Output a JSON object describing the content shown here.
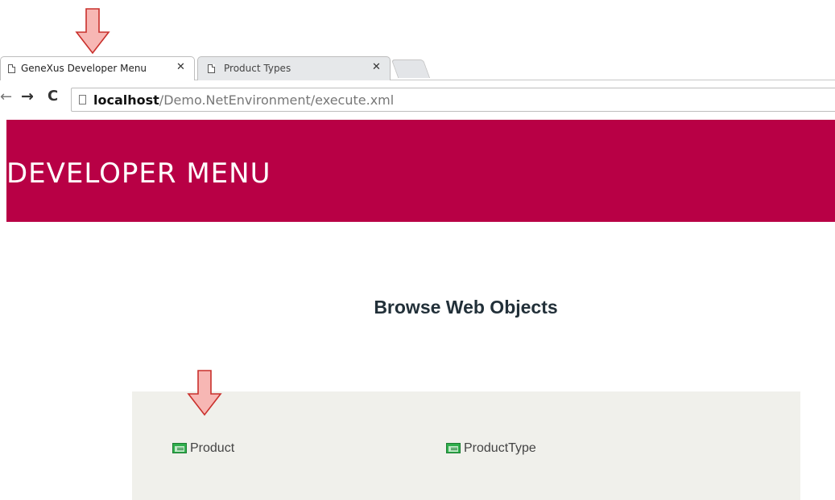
{
  "browser": {
    "tabs": [
      {
        "title": "GeneXus Developer Menu",
        "close": "✕",
        "active": true
      },
      {
        "title": "Product Types",
        "close": "✕",
        "active": false
      }
    ],
    "nav": {
      "back": "←",
      "forward": "→",
      "reload": "C"
    },
    "address": {
      "host": "localhost",
      "path": "/Demo.NetEnvironment/execute.xml"
    }
  },
  "page": {
    "header_title": "DEVELOPER MENU",
    "section_title": "Browse Web Objects",
    "objects": [
      {
        "label": "Product",
        "icon": "web-object-icon"
      },
      {
        "label": "ProductType",
        "icon": "web-object-icon"
      }
    ]
  },
  "colors": {
    "banner": "#b80045",
    "panel": "#f0f0eb",
    "annotation_arrow": "#f7b7b4"
  }
}
